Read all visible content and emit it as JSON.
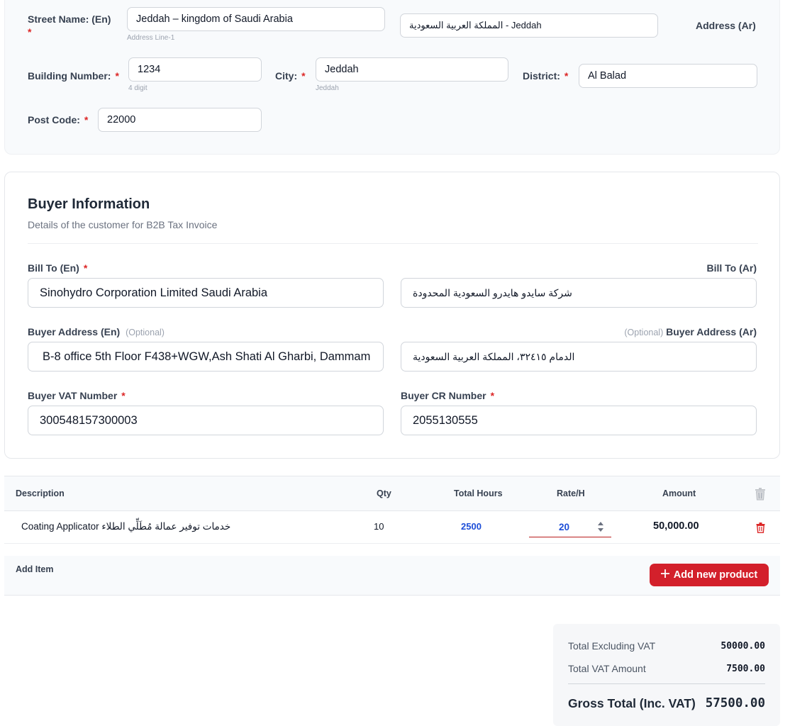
{
  "address": {
    "street_label": "Street Name: (En)",
    "street_value": "Jeddah – kingdom of Saudi Arabia",
    "street_hint": "Address Line-1",
    "address_ar_value": "Jeddah - المملكة العربية السعودية",
    "address_ar_label": "Address (Ar)",
    "building_label": "Building Number:",
    "building_value": "1234",
    "building_hint": "4 digit",
    "city_label": "City:",
    "city_value": "Jeddah",
    "city_hint": "Jeddah",
    "district_label": "District:",
    "district_value": "Al Balad",
    "postcode_label": "Post Code:",
    "postcode_value": "22000",
    "required_mark": "*"
  },
  "buyer": {
    "title": "Buyer Information",
    "subtitle": "Details of the customer for B2B Tax Invoice",
    "bill_to_en_label": "Bill To (En)",
    "bill_to_en_value": "Sinohydro Corporation Limited Saudi Arabia",
    "bill_to_ar_label": "Bill To (Ar)",
    "bill_to_ar_value": "شركة سايدو هايدرو السعودية المحدودة",
    "address_en_label": "Buyer Address (En)",
    "address_en_value": "B-8 office 5th Floor F438+WGW,Ash Shati Al Gharbi, Dammam",
    "address_ar_label": "Buyer Address (Ar)",
    "address_ar_value": "الدمام ٣٢٤١٥، المملكة العربية السعودية",
    "optional": "(Optional)",
    "vat_label": "Buyer VAT Number",
    "vat_value": "300548157300003",
    "cr_label": "Buyer CR Number",
    "cr_value": "2055130555",
    "required_mark": "*"
  },
  "table": {
    "headers": {
      "description": "Description",
      "qty": "Qty",
      "total_hours": "Total Hours",
      "rate": "Rate/H",
      "amount": "Amount"
    },
    "rows": [
      {
        "description": "Coating Applicator خدمات توفير عمالة مُطَلِّي الطلاء",
        "qty": "10",
        "total_hours": "2500",
        "rate": "20",
        "amount": "50,000.00"
      }
    ],
    "add_item_label": "Add Item",
    "add_button_label": "Add new product",
    "colors": {
      "accent": "#d3202b",
      "hours": "#1d4ed8"
    }
  },
  "totals": {
    "excl_label": "Total Excluding VAT",
    "excl_value": "50000.00",
    "vat_label": "Total VAT Amount",
    "vat_value": "7500.00",
    "gross_label": "Gross Total (Inc. VAT)",
    "gross_value": "57500.00"
  }
}
